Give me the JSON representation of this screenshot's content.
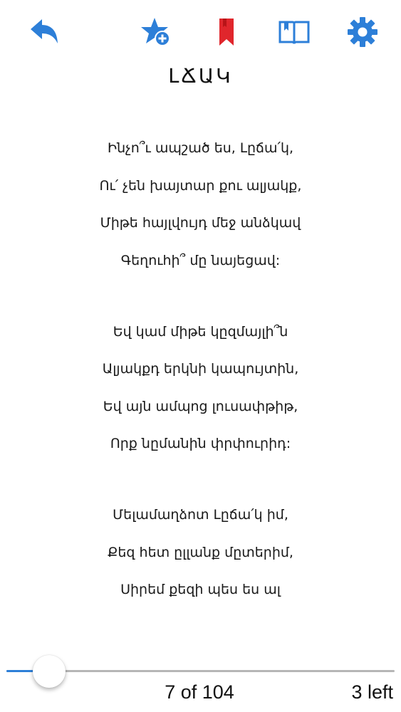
{
  "colors": {
    "accent": "#2d7fd8",
    "bookmark": "#e0262c",
    "track": "#b6b6b6"
  },
  "toolbar": {
    "icons": [
      "back-arrow-icon",
      "star-add-icon",
      "bookmark-icon",
      "book-contents-icon",
      "gear-icon"
    ]
  },
  "title": "ԼՃԱԿ",
  "poem": {
    "stanzas": [
      [
        "Ինչո՞ւ ապշած ես, Լըճա՛կ,",
        "Ու՛ չեն խայտար քու ալյակք,",
        "Միթե հայլվույդ մեջ անձկավ",
        "Գեղուհի՞ մը նայեցավ:"
      ],
      [
        "Եվ կամ միթե կըզմայլի՞ն",
        "Ալյակքդ երկնի կապույտին,",
        "Եվ այն ամպոց լուսափթիթ,",
        "Որք նըմանին փրփուրիդ:"
      ],
      [
        "Մելամաղձոտ Լըճա՛կ իմ,",
        "Քեզ հետ ըլլանք մըտերիմ,",
        "Սիրեմ քեզի պես ես ալ"
      ]
    ]
  },
  "pager": {
    "current": 7,
    "total": 104,
    "progress": 0.058,
    "position_label": "7 of 104",
    "remaining_label": "3 left"
  }
}
